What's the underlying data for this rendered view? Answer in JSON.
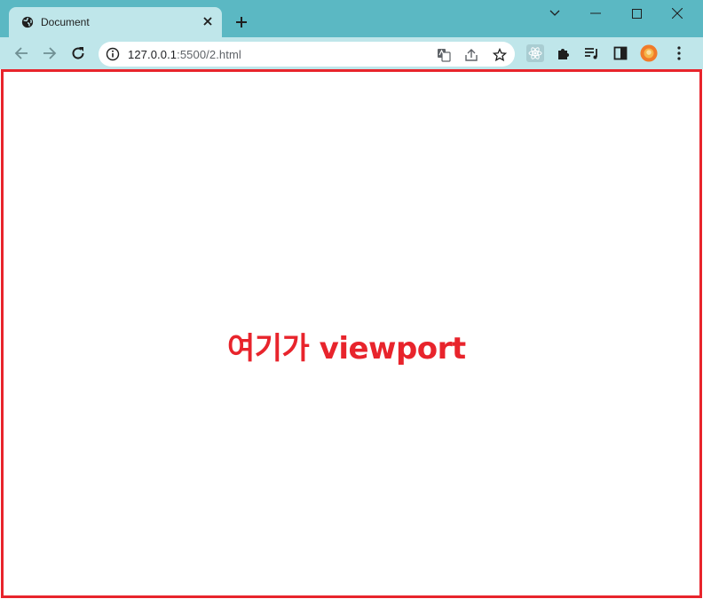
{
  "browser": {
    "tab": {
      "title": "Document"
    },
    "address_bar": {
      "host": "127.0.0.1",
      "port_path": ":5500/2.html"
    }
  },
  "viewport": {
    "label": "여기가 viewport"
  },
  "colors": {
    "titlebar": "#5bb8c3",
    "toolbar": "#bfe6ea",
    "annotation": "#e8242c",
    "profile": "#f07b2a"
  }
}
